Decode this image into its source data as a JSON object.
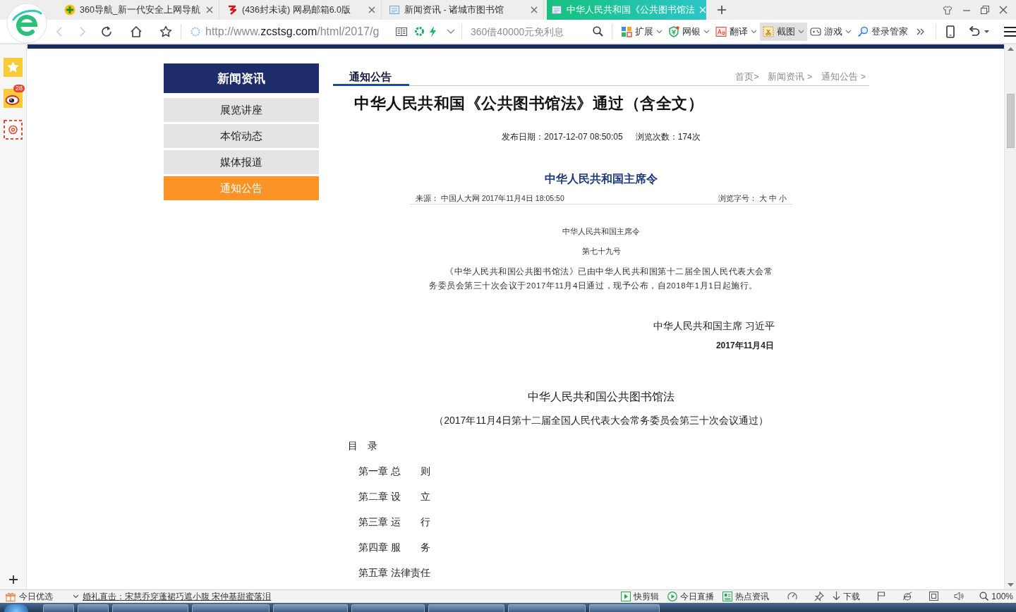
{
  "browser": {
    "tabs": [
      {
        "title": "360导航_新一代安全上网导航",
        "selected": false
      },
      {
        "title": "(436封未读) 网易邮箱6.0版",
        "selected": false
      },
      {
        "title": "新闻资讯 - 诸城市图书馆",
        "selected": false
      },
      {
        "title": "中华人民共和国《公共图书馆法",
        "selected": true
      }
    ],
    "navigation": {
      "back_disabled": true,
      "forward_disabled": true
    },
    "address_bar": {
      "url_start": "http://www.",
      "url_domain": "zcstsg.com",
      "url_rest": "/html/2017/g"
    },
    "search": {
      "placeholder": "360借40000元免利息"
    },
    "toolbar": [
      {
        "label": "扩展",
        "dropdown": true,
        "selected": false
      },
      {
        "label": "网银",
        "dropdown": true,
        "selected": false
      },
      {
        "label": "翻译",
        "dropdown": true,
        "selected": false
      },
      {
        "label": "截图",
        "dropdown": true,
        "selected": true
      },
      {
        "label": "游戏",
        "dropdown": true,
        "selected": false
      },
      {
        "label": "登录管家",
        "dropdown": false,
        "selected": false
      }
    ]
  },
  "sidebar": {
    "notification_count": "28"
  },
  "page": {
    "nav": {
      "title": "新闻资讯",
      "items": [
        {
          "label": "展览讲座",
          "selected": false
        },
        {
          "label": "本馆动态",
          "selected": false
        },
        {
          "label": "媒体报道",
          "selected": false
        },
        {
          "label": "通知公告",
          "selected": true
        }
      ]
    },
    "section_title": "通知公告",
    "breadcrumb": [
      "首页>",
      "新闻资讯 >",
      "通知公告 >"
    ],
    "article": {
      "title": "中华人民共和国《公共图书馆法》通过（含全文）",
      "published": "发布日期：2017-12-07 08:50:05",
      "views": "浏览次数：174次",
      "document_image": {
        "title": "中华人民共和国主席令",
        "source": "来源：  中国人大网 2017年11月4日 18:05:50",
        "font_size": "浏览字号：  大  中  小",
        "heading": "中华人民共和国主席令",
        "number": "第七十九号",
        "body": "《中华人民共和国公共图书馆法》已由中华人民共和国第十二届全国人民代表大会常务委员会第三十次会议于2017年11月4日通过，现予公布，自2018年1月1日起施行。",
        "signature": "中华人民共和国主席 习近平",
        "date": "2017年11月4日"
      },
      "law_title": "中华人民共和国公共图书馆法",
      "law_subtitle": "（2017年11月4日第十二届全国人民代表大会常务委员会第三十次会议通过）",
      "toc_heading": "目　录",
      "toc": [
        "第一章 总　　则",
        "第二章 设　　立",
        "第三章 运　　行",
        "第四章 服　　务",
        "第五章 法律责任"
      ]
    }
  },
  "status_bar": {
    "label": "今日优选",
    "headline": "婚礼直击：宋慧乔穿蓬裙巧遮小腹 宋仲基甜蜜落泪",
    "tools": [
      "快剪辑",
      "今日直播",
      "热点资讯"
    ],
    "download": "下载",
    "zoom": "100%"
  }
}
